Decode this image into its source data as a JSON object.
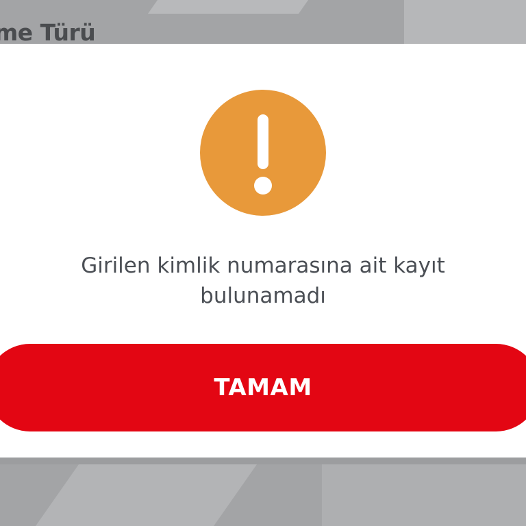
{
  "background": {
    "partial_title": "eme Türü"
  },
  "dialog": {
    "icon": "warning-exclamation-icon",
    "icon_color": "#e8993a",
    "message": "Girilen kimlik numarasına ait kayıt bulunamadı",
    "button_label": "TAMAM",
    "button_color": "#e30613"
  }
}
